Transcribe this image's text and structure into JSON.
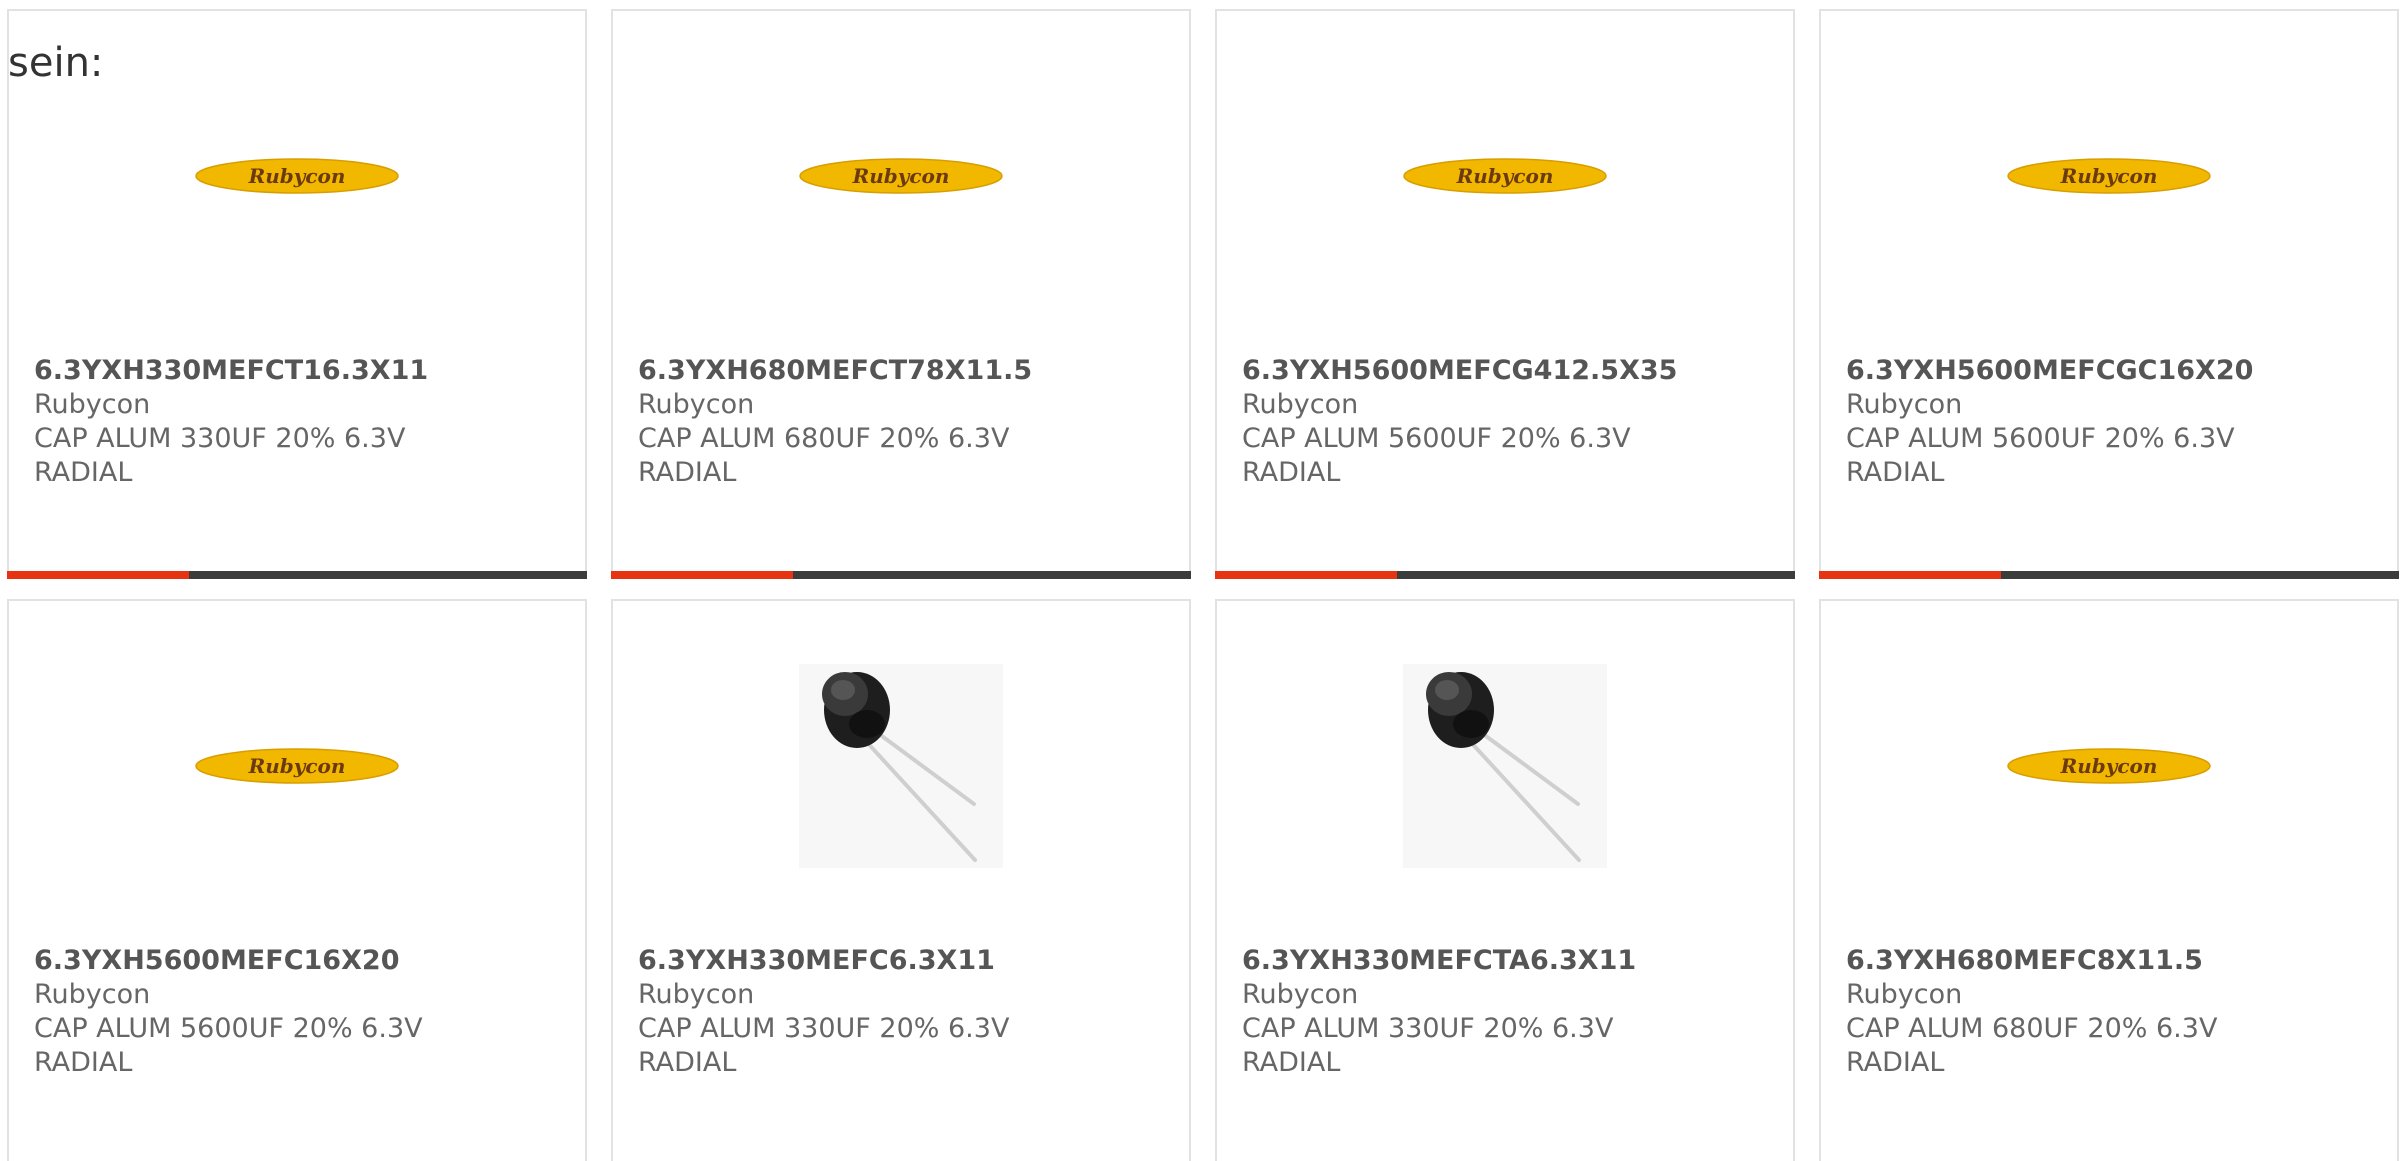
{
  "heading": "sein:",
  "colors": {
    "accent": "#e63312",
    "bar": "#3c3c3c",
    "card_border": "#e2e2e2",
    "logo_yellow": "#f2b800",
    "logo_text": "#6b3a10"
  },
  "products": [
    {
      "part": "6.3YXH330MEFCT16.3X11",
      "brand": "Rubycon",
      "desc_line1": "CAP ALUM 330UF 20% 6.3V",
      "desc_line2": "RADIAL",
      "image": "rubycon-logo"
    },
    {
      "part": "6.3YXH680MEFCT78X11.5",
      "brand": "Rubycon",
      "desc_line1": "CAP ALUM 680UF 20% 6.3V",
      "desc_line2": "RADIAL",
      "image": "rubycon-logo"
    },
    {
      "part": "6.3YXH5600MEFCG412.5X35",
      "brand": "Rubycon",
      "desc_line1": "CAP ALUM 5600UF 20% 6.3V",
      "desc_line2": "RADIAL",
      "image": "rubycon-logo"
    },
    {
      "part": "6.3YXH5600MEFCGC16X20",
      "brand": "Rubycon",
      "desc_line1": "CAP ALUM 5600UF 20% 6.3V",
      "desc_line2": "RADIAL",
      "image": "rubycon-logo"
    },
    {
      "part": "6.3YXH5600MEFC16X20",
      "brand": "Rubycon",
      "desc_line1": "CAP ALUM 5600UF 20% 6.3V",
      "desc_line2": "RADIAL",
      "image": "rubycon-logo"
    },
    {
      "part": "6.3YXH330MEFC6.3X11",
      "brand": "Rubycon",
      "desc_line1": "CAP ALUM 330UF 20% 6.3V",
      "desc_line2": "RADIAL",
      "image": "capacitor-photo"
    },
    {
      "part": "6.3YXH330MEFCTA6.3X11",
      "brand": "Rubycon",
      "desc_line1": "CAP ALUM 330UF 20% 6.3V",
      "desc_line2": "RADIAL",
      "image": "capacitor-photo"
    },
    {
      "part": "6.3YXH680MEFC8X11.5",
      "brand": "Rubycon",
      "desc_line1": "CAP ALUM 680UF 20% 6.3V",
      "desc_line2": "RADIAL",
      "image": "rubycon-logo"
    }
  ],
  "logo_text": "Rubycon"
}
